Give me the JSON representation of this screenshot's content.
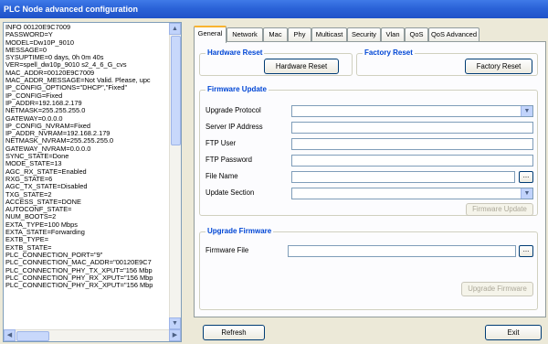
{
  "window": {
    "title": "PLC Node advanced configuration"
  },
  "info_lines": [
    "INFO 00120E9C7009",
    "PASSWORD=Y",
    "MODEL=Dw10P_9010",
    "MESSAGE=0",
    "SYSUPTIME=0 days, 0h 0m 40s",
    "VER=spell_dw10p_9010 s2_4_6_G_cvs",
    "MAC_ADDR=00120E9C7009",
    "MAC_ADDR_MESSAGE=Not Valid. Please, upc",
    "IP_CONFIG_OPTIONS=\"DHCP\",\"Fixed\"",
    "IP_CONFIG=Fixed",
    "IP_ADDR=192.168.2.179",
    "NETMASK=255.255.255.0",
    "GATEWAY=0.0.0.0",
    "IP_CONFIG_NVRAM=Fixed",
    "IP_ADDR_NVRAM=192.168.2.179",
    "NETMASK_NVRAM=255.255.255.0",
    "GATEWAY_NVRAM=0.0.0.0",
    "SYNC_STATE=Done",
    "MODE_STATE=13",
    "AGC_RX_STATE=Enabled",
    "RXG_STATE=6",
    "AGC_TX_STATE=Disabled",
    "TXG_STATE=2",
    "ACCESS_STATE=DONE",
    "AUTOCONF_STATE=",
    "NUM_BOOTS=2",
    "EXTA_TYPE=100 Mbps",
    "EXTA_STATE=Forwarding",
    "EXTB_TYPE=",
    "EXTB_STATE=",
    "PLC_CONNECTION_PORT=\"9\"",
    "PLC_CONNECTION_MAC_ADDR=\"00120E9C7",
    "PLC_CONNECTION_PHY_TX_XPUT=\"156 Mbp",
    "PLC_CONNECTION_PHY_RX_XPUT=\"156 Mbp",
    "PLC_CONNECTION_PHY_RX_XPUT=\"156 Mbp"
  ],
  "tabs": [
    {
      "label": "General",
      "active": true
    },
    {
      "label": "Network"
    },
    {
      "label": "Mac"
    },
    {
      "label": "Phy"
    },
    {
      "label": "Multicast"
    },
    {
      "label": "Security"
    },
    {
      "label": "Vlan"
    },
    {
      "label": "QoS"
    },
    {
      "label": "QoS Advanced"
    }
  ],
  "hardware_reset": {
    "title": "Hardware Reset",
    "button": "Hardware Reset"
  },
  "factory_reset": {
    "title": "Factory Reset",
    "button": "Factory Reset"
  },
  "firmware_update": {
    "title": "Firmware Update",
    "upgrade_protocol_label": "Upgrade Protocol",
    "upgrade_protocol_value": "",
    "server_ip_label": "Server IP Address",
    "server_ip_value": "",
    "ftp_user_label": "FTP User",
    "ftp_user_value": "",
    "ftp_password_label": "FTP Password",
    "ftp_password_value": "",
    "file_name_label": "File Name",
    "file_name_value": "",
    "browse_label": "...",
    "update_section_label": "Update Section",
    "update_section_value": "",
    "button": "Firmware Update"
  },
  "upgrade_firmware": {
    "title": "Upgrade Firmware",
    "firmware_file_label": "Firmware File",
    "firmware_file_value": "",
    "browse_label": "...",
    "button": "Upgrade Firmware"
  },
  "footer": {
    "refresh": "Refresh",
    "exit": "Exit"
  },
  "icons": {
    "scroll_up": "scroll-up-icon",
    "scroll_down": "scroll-down-icon",
    "scroll_left": "scroll-left-icon",
    "scroll_right": "scroll-right-icon",
    "dropdown": "chevron-down-icon"
  },
  "colors": {
    "titlebar": "#2b63d8",
    "group_title": "#0046d5",
    "tab_highlight": "#f8b330",
    "window_bg": "#ece9d8"
  }
}
